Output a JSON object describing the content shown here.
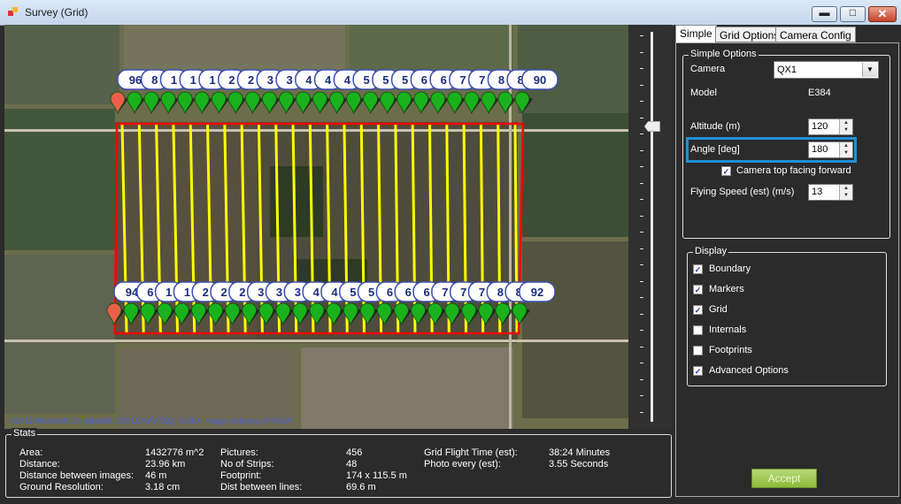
{
  "window": {
    "title": "Survey (Grid)",
    "min_glyph": "▬",
    "max_glyph": "□",
    "close_glyph": "✕"
  },
  "map": {
    "copyright": "©2016 Microsoft Corporation, ©2016 NAVTEQ, ©2016 Image courtesy of NASA",
    "top_markers": [
      "96",
      "8",
      "1",
      "1",
      "1",
      "2",
      "2",
      "3",
      "3",
      "4",
      "4",
      "4",
      "5",
      "5",
      "5",
      "6",
      "6",
      "7",
      "7",
      "8",
      "8",
      "90"
    ],
    "bottom_markers": [
      "94",
      "6",
      "1",
      "1",
      "2",
      "2",
      "2",
      "3",
      "3",
      "3",
      "4",
      "4",
      "5",
      "5",
      "6",
      "6",
      "6",
      "7",
      "7",
      "7",
      "8",
      "8",
      "92"
    ],
    "boundary_color": "#ff0000",
    "grid_color": "#ffff00",
    "marker_color": "#19b21c",
    "strip_count": 24
  },
  "stats": {
    "legend": "Stats",
    "col1": [
      {
        "label": "Area:",
        "value": "1432776 m^2"
      },
      {
        "label": "Distance:",
        "value": "23.96 km"
      },
      {
        "label": "Distance between images:",
        "value": "46 m"
      },
      {
        "label": "Ground Resolution:",
        "value": "3.18 cm"
      }
    ],
    "col2": [
      {
        "label": "Pictures:",
        "value": "456"
      },
      {
        "label": "No of Strips:",
        "value": "48"
      },
      {
        "label": "Footprint:",
        "value": "174 x 115.5 m"
      },
      {
        "label": "Dist between lines:",
        "value": "69.6 m"
      }
    ],
    "col3": [
      {
        "label": "Grid Flight Time (est):",
        "value": "38:24 Minutes"
      },
      {
        "label": "Photo every (est):",
        "value": "3.55 Seconds"
      }
    ]
  },
  "tabs": [
    "Simple",
    "Grid Options",
    "Camera Config"
  ],
  "simple_options": {
    "legend": "Simple Options",
    "camera_label": "Camera",
    "camera_value": "QX1",
    "model_label": "Model",
    "model_value": "E384",
    "altitude_label": "Altitude (m)",
    "altitude_value": "120",
    "angle_label": "Angle [deg]",
    "angle_value": "180",
    "camera_top_label": "Camera top facing forward",
    "camera_top_checked": true,
    "speed_label": "Flying Speed (est) (m/s)",
    "speed_value": "13"
  },
  "display": {
    "legend": "Display",
    "items": [
      {
        "label": "Boundary",
        "checked": true
      },
      {
        "label": "Markers",
        "checked": true
      },
      {
        "label": "Grid",
        "checked": true
      },
      {
        "label": "Internals",
        "checked": false
      },
      {
        "label": "Footprints",
        "checked": false
      },
      {
        "label": "Advanced Options",
        "checked": true
      }
    ]
  },
  "accept_label": "Accept",
  "highlight_color": "#1f90d8"
}
